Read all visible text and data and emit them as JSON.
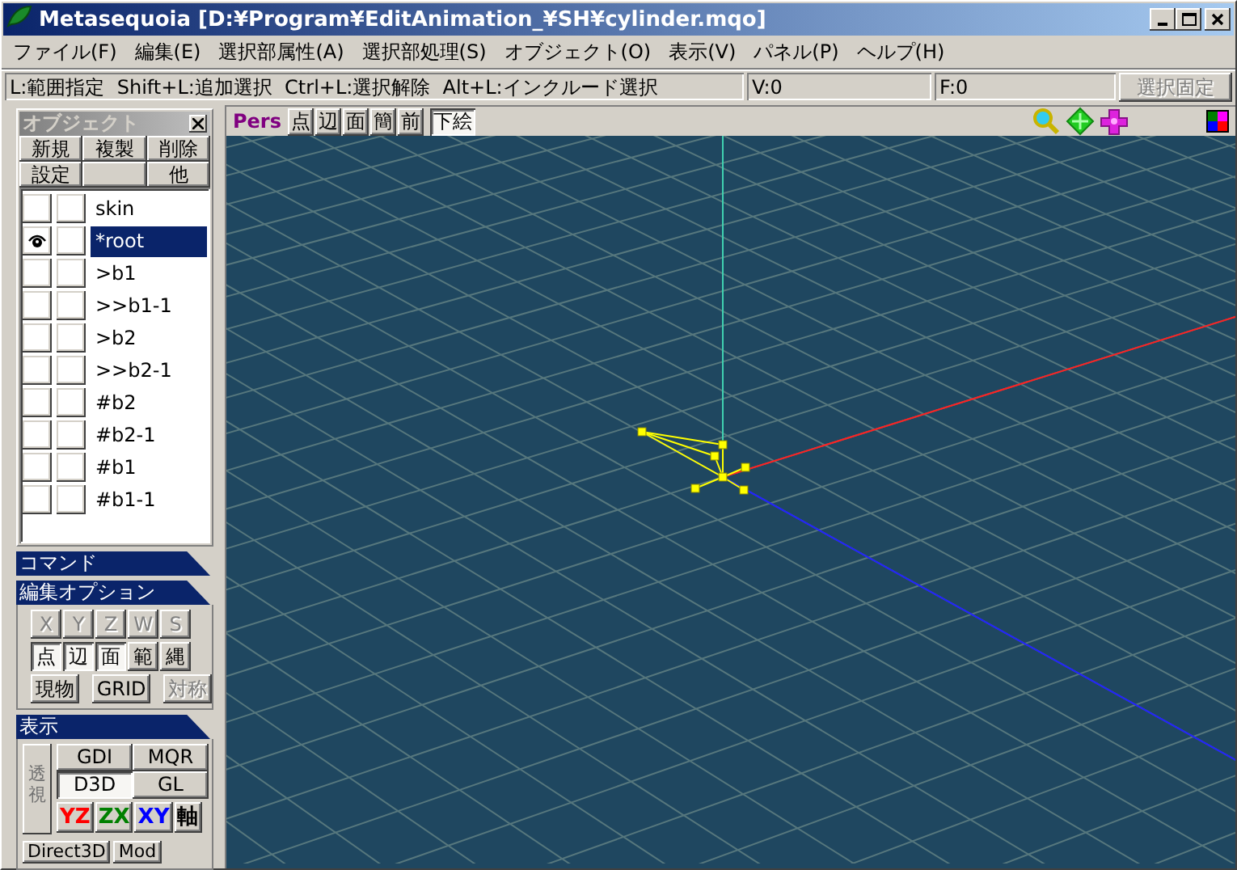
{
  "window": {
    "title": "Metasequoia [D:¥Program¥EditAnimation_¥SH¥cylinder.mqo]"
  },
  "menu": [
    "ファイル(F)",
    "編集(E)",
    "選択部属性(A)",
    "選択部処理(S)",
    "オブジェクト(O)",
    "表示(V)",
    "パネル(P)",
    "ヘルプ(H)"
  ],
  "status_bar": {
    "hint": "L:範囲指定  Shift+L:追加選択  Ctrl+L:選択解除  Alt+L:インクルード選択",
    "vertices": "V:0",
    "faces": "F:0",
    "lock_button": {
      "label": "選択固定",
      "disabled": true
    }
  },
  "object_panel": {
    "title": "オブジェクト",
    "buttons": [
      "新規",
      "複製",
      "削除",
      "設定",
      "他"
    ],
    "objects": [
      {
        "name": "skin",
        "visible": false,
        "locked": false,
        "selected": false
      },
      {
        "name": "*root",
        "visible": true,
        "locked": false,
        "selected": true
      },
      {
        "name": ">b1",
        "visible": false,
        "locked": false,
        "selected": false
      },
      {
        "name": ">>b1-1",
        "visible": false,
        "locked": false,
        "selected": false
      },
      {
        "name": ">b2",
        "visible": false,
        "locked": false,
        "selected": false
      },
      {
        "name": ">>b2-1",
        "visible": false,
        "locked": false,
        "selected": false
      },
      {
        "name": "#b2",
        "visible": false,
        "locked": false,
        "selected": false
      },
      {
        "name": "#b2-1",
        "visible": false,
        "locked": false,
        "selected": false
      },
      {
        "name": "#b1",
        "visible": false,
        "locked": false,
        "selected": false
      },
      {
        "name": "#b1-1",
        "visible": false,
        "locked": false,
        "selected": false
      }
    ]
  },
  "command_panel": {
    "title": "コマンド"
  },
  "edit_options": {
    "title": "編集オプション",
    "axis_buttons": [
      {
        "label": "X",
        "disabled": true,
        "selected": false
      },
      {
        "label": "Y",
        "disabled": true,
        "selected": false
      },
      {
        "label": "Z",
        "disabled": true,
        "selected": false
      },
      {
        "label": "W",
        "disabled": true,
        "selected": false
      },
      {
        "label": "S",
        "disabled": true,
        "selected": false
      }
    ],
    "mode_buttons": [
      {
        "label": "点",
        "disabled": false,
        "selected": true
      },
      {
        "label": "辺",
        "disabled": false,
        "selected": true
      },
      {
        "label": "面",
        "disabled": false,
        "selected": true
      },
      {
        "label": "範",
        "disabled": false,
        "selected": false
      },
      {
        "label": "縄",
        "disabled": false,
        "selected": false
      }
    ],
    "tool_buttons": [
      {
        "label": "現物",
        "disabled": false,
        "selected": false
      },
      {
        "label": "GRID",
        "disabled": false,
        "selected": false
      },
      {
        "label": "対称",
        "disabled": true,
        "selected": false
      }
    ]
  },
  "display_panel": {
    "title": "表示",
    "perspective": {
      "label": "透視",
      "disabled": true
    },
    "renderers": [
      {
        "label": "GDI",
        "selected": false
      },
      {
        "label": "MQR",
        "selected": false
      },
      {
        "label": "D3D",
        "selected": true
      },
      {
        "label": "GL",
        "selected": false
      }
    ],
    "views": [
      {
        "label": "YZ",
        "color": "#ff0000",
        "selected": false
      },
      {
        "label": "ZX",
        "color": "#008000",
        "selected": false
      },
      {
        "label": "XY",
        "color": "#0000ff",
        "selected": false
      },
      {
        "label": "軸",
        "color": "#000000",
        "selected": false
      }
    ],
    "bottom": [
      "Direct3D",
      "Mod"
    ]
  },
  "viewport": {
    "mode": "Pers",
    "buttons": [
      {
        "label": "点",
        "selected": false
      },
      {
        "label": "辺",
        "selected": false
      },
      {
        "label": "面",
        "selected": false
      },
      {
        "label": "簡",
        "selected": false
      },
      {
        "label": "前",
        "selected": false
      },
      {
        "label": "下絵",
        "selected": true
      }
    ]
  }
}
